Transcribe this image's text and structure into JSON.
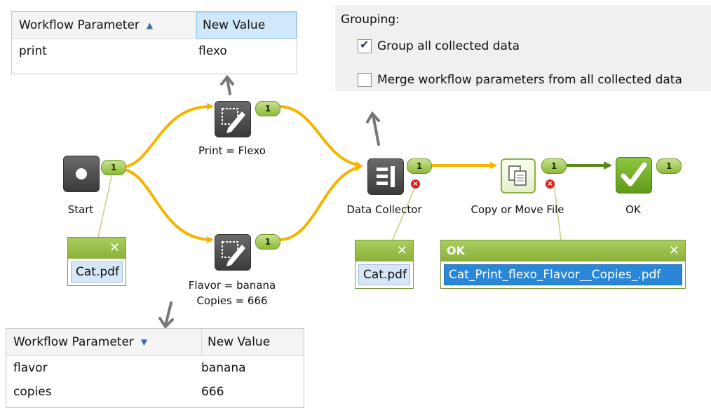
{
  "top_table": {
    "col1": "Workflow Parameter",
    "col2": "New Value",
    "rows": [
      {
        "param": "print",
        "value": "flexo"
      }
    ]
  },
  "bottom_table": {
    "col1": "Workflow Parameter",
    "col2": "New Value",
    "rows": [
      {
        "param": "flavor",
        "value": "banana"
      },
      {
        "param": "copies",
        "value": "666"
      }
    ]
  },
  "grouping": {
    "title": "Grouping:",
    "options": [
      {
        "label": "Group all collected data",
        "checked": true
      },
      {
        "label": "Merge workflow parameters from all collected data",
        "checked": false
      }
    ]
  },
  "nodes": {
    "start": {
      "label": "Start",
      "count": "1"
    },
    "print": {
      "label": "Print = Flexo",
      "count": "1"
    },
    "flavor": {
      "label1": "Flavor = banana",
      "label2": "Copies = 666",
      "count": "1"
    },
    "collector": {
      "label": "Data Collector",
      "count": "1"
    },
    "copy": {
      "label": "Copy or Move File",
      "count": "1"
    },
    "ok": {
      "label": "OK",
      "count": "1"
    }
  },
  "cards": {
    "start_file": "Cat.pdf",
    "collector_file": "Cat.pdf",
    "ok_title": "OK",
    "ok_file": "Cat_Print_flexo_Flavor__Copies_.pdf"
  },
  "colors": {
    "flow": "#f5b400",
    "flow_dark": "#5a8a1a",
    "pointer": "#777777",
    "accent": "#8bb13a"
  }
}
